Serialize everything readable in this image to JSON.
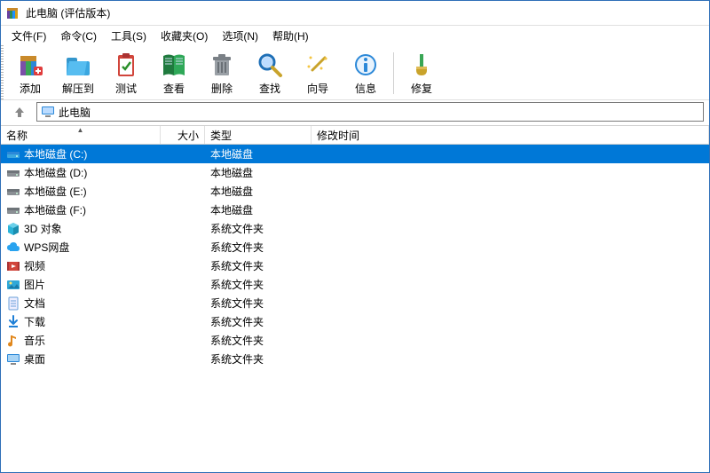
{
  "window": {
    "title": "此电脑 (评估版本)"
  },
  "menu": {
    "file": "文件(F)",
    "command": "命令(C)",
    "tools": "工具(S)",
    "favorites": "收藏夹(O)",
    "options": "选项(N)",
    "help": "帮助(H)"
  },
  "toolbar": {
    "add": "添加",
    "extract": "解压到",
    "test": "测试",
    "view": "查看",
    "delete": "删除",
    "find": "查找",
    "wizard": "向导",
    "info": "信息",
    "repair": "修复"
  },
  "address": {
    "path": "此电脑"
  },
  "columns": {
    "name": "名称",
    "size": "大小",
    "type": "类型",
    "date": "修改时间"
  },
  "rows": [
    {
      "icon": "drive-c",
      "name": "本地磁盘 (C:)",
      "type": "本地磁盘",
      "selected": true
    },
    {
      "icon": "drive",
      "name": "本地磁盘 (D:)",
      "type": "本地磁盘",
      "selected": false
    },
    {
      "icon": "drive",
      "name": "本地磁盘 (E:)",
      "type": "本地磁盘",
      "selected": false
    },
    {
      "icon": "drive",
      "name": "本地磁盘 (F:)",
      "type": "本地磁盘",
      "selected": false
    },
    {
      "icon": "3d",
      "name": "3D 对象",
      "type": "系统文件夹",
      "selected": false
    },
    {
      "icon": "wps",
      "name": "WPS网盘",
      "type": "系统文件夹",
      "selected": false
    },
    {
      "icon": "video",
      "name": "视频",
      "type": "系统文件夹",
      "selected": false
    },
    {
      "icon": "pictures",
      "name": "图片",
      "type": "系统文件夹",
      "selected": false
    },
    {
      "icon": "docs",
      "name": "文档",
      "type": "系统文件夹",
      "selected": false
    },
    {
      "icon": "download",
      "name": "下载",
      "type": "系统文件夹",
      "selected": false
    },
    {
      "icon": "music",
      "name": "音乐",
      "type": "系统文件夹",
      "selected": false
    },
    {
      "icon": "desktop",
      "name": "桌面",
      "type": "系统文件夹",
      "selected": false
    }
  ]
}
